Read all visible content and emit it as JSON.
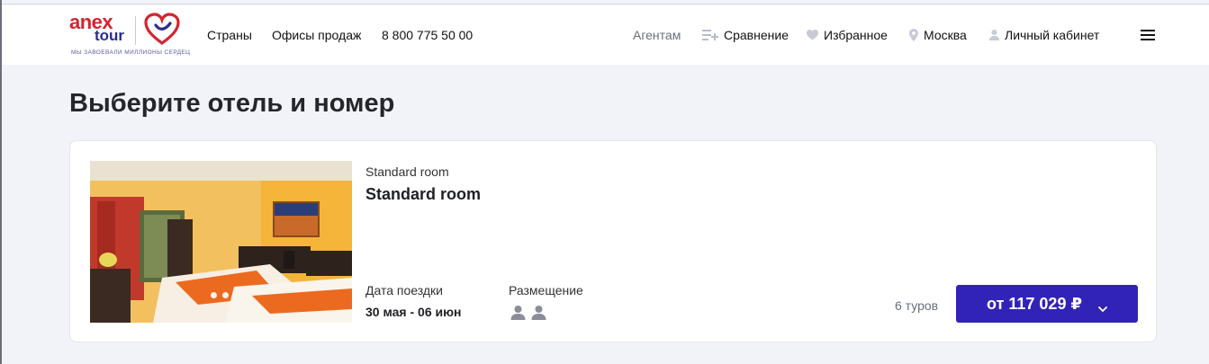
{
  "header": {
    "logo": {
      "word1": "anex",
      "word2": "tour",
      "slogan": "МЫ ЗАВОЕВАЛИ МИЛЛИОНЫ СЕРДЕЦ"
    },
    "nav_left": {
      "countries": "Страны",
      "offices": "Офисы продаж",
      "phone": "8 800 775 50 00"
    },
    "nav_right": {
      "agents": "Агентам",
      "compare": "Сравнение",
      "favorites": "Избранное",
      "city": "Москва",
      "account": "Личный кабинет"
    },
    "icons": {
      "compare": "compare-icon",
      "favorites": "heart-icon",
      "city": "location-pin-icon",
      "account": "user-icon",
      "menu": "hamburger-menu-icon"
    }
  },
  "page": {
    "title": "Выберите отель и номер"
  },
  "room_card": {
    "image": "hotel-room-photo",
    "carousel_dots": 2,
    "category": "Standard room",
    "name": "Standard room",
    "date_label": "Дата поездки",
    "date_value": "30 мая - 06 июн",
    "accommodation_label": "Размещение",
    "guests": 2,
    "tours_count": "6 туров",
    "price_button": "от 117 029 ₽"
  },
  "colors": {
    "brand_red": "#d6232f",
    "brand_blue": "#2b2e88",
    "button": "#3223b8",
    "background": "#f2f3f8"
  }
}
